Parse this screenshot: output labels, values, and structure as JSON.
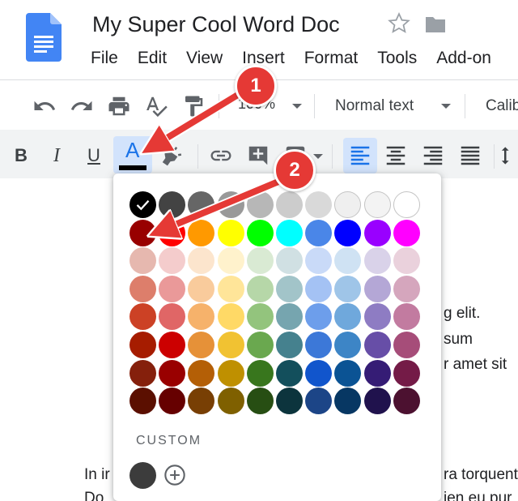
{
  "doc": {
    "title": "My Super Cool Word Doc"
  },
  "menu": [
    "File",
    "Edit",
    "View",
    "Insert",
    "Format",
    "Tools",
    "Add-on"
  ],
  "toolbar": {
    "zoom": "100%",
    "paragraph_style": "Normal text",
    "font": "Calib"
  },
  "format_buttons": {
    "bold": "B",
    "italic": "I",
    "underline": "U",
    "text_color": "A"
  },
  "doc_body": {
    "line1_tail": "g elit.",
    "line2_tail": "sum",
    "line3_tail": "r amet sit",
    "line4_head": "In ir",
    "line4_tail": "ra torquent",
    "line5_head": "Do",
    "line5_tail": "ien eu pur"
  },
  "palette": {
    "custom_label": "CUSTOM",
    "selected": "#000000",
    "rows": [
      [
        "#000000",
        "#434343",
        "#666666",
        "#999999",
        "#b7b7b7",
        "#cccccc",
        "#d9d9d9",
        "#efefef",
        "#f3f3f3",
        "#ffffff"
      ],
      [
        "#980000",
        "#ff0000",
        "#ff9900",
        "#ffff00",
        "#00ff00",
        "#00ffff",
        "#4a86e8",
        "#0000ff",
        "#9900ff",
        "#ff00ff"
      ],
      [
        "#e6b8af",
        "#f4cccc",
        "#fce5cd",
        "#fff2cc",
        "#d9ead3",
        "#d0e0e3",
        "#c9daf8",
        "#cfe2f3",
        "#d9d2e9",
        "#ead1dc"
      ],
      [
        "#dd7e6b",
        "#ea9999",
        "#f9cb9c",
        "#ffe599",
        "#b6d7a8",
        "#a2c4c9",
        "#a4c2f4",
        "#9fc5e8",
        "#b4a7d6",
        "#d5a6bd"
      ],
      [
        "#cc4125",
        "#e06666",
        "#f6b26b",
        "#ffd966",
        "#93c47d",
        "#76a5af",
        "#6d9eeb",
        "#6fa8dc",
        "#8e7cc3",
        "#c27ba0"
      ],
      [
        "#a61c00",
        "#cc0000",
        "#e69138",
        "#f1c232",
        "#6aa84f",
        "#45818e",
        "#3c78d8",
        "#3d85c6",
        "#674ea7",
        "#a64d79"
      ],
      [
        "#85200c",
        "#990000",
        "#b45f06",
        "#bf9000",
        "#38761d",
        "#134f5c",
        "#1155cc",
        "#0b5394",
        "#351c75",
        "#741b47"
      ],
      [
        "#5b0f00",
        "#660000",
        "#783f04",
        "#7f6000",
        "#274e13",
        "#0c343d",
        "#1c4587",
        "#073763",
        "#20124d",
        "#4c1130"
      ]
    ],
    "custom_color": "#3c3c3c"
  },
  "annotations": {
    "badge1": "1",
    "badge2": "2",
    "color": "#e53935"
  }
}
